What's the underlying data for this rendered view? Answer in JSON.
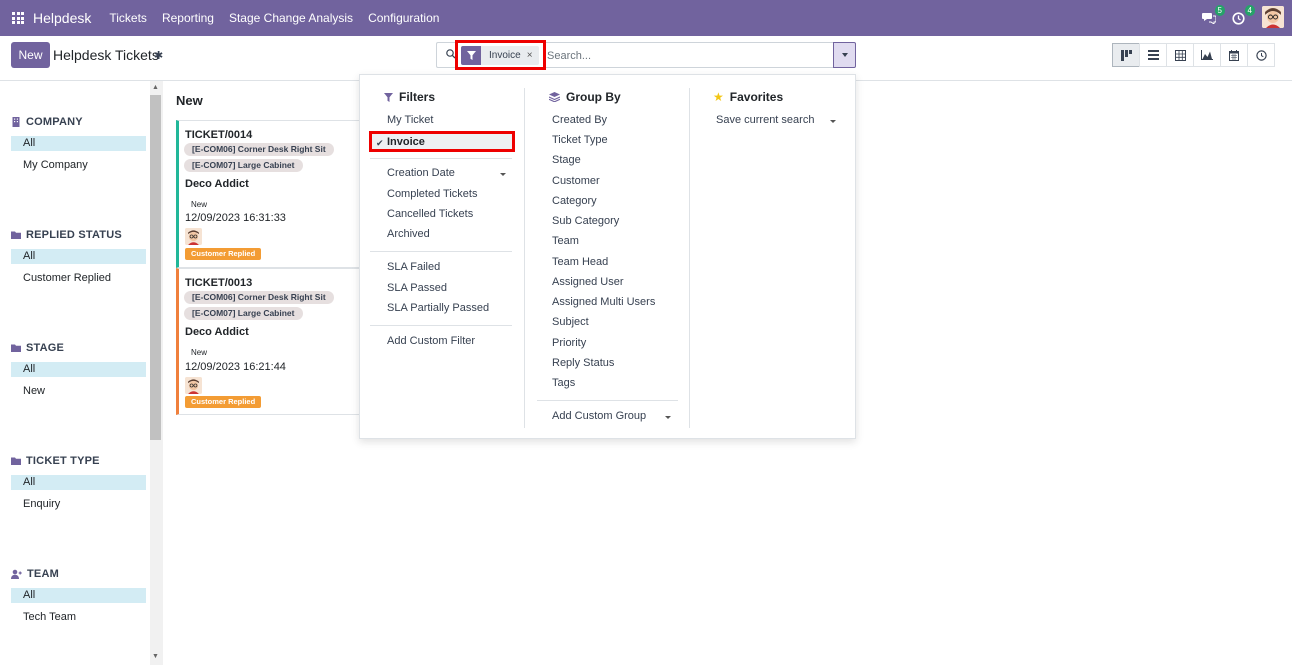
{
  "nav": {
    "brand": "Helpdesk",
    "menu": [
      "Tickets",
      "Reporting",
      "Stage Change Analysis",
      "Configuration"
    ],
    "messages_count": "5",
    "activities_count": "4"
  },
  "control": {
    "new_label": "New",
    "title": "Helpdesk Tickets",
    "facet_label": "Invoice",
    "facet_remove": "×",
    "search_placeholder": "Search..."
  },
  "sidebar": {
    "sections": [
      {
        "title": "COMPANY",
        "icon": "building-icon",
        "options": [
          "All",
          "My Company"
        ]
      },
      {
        "title": "REPLIED STATUS",
        "icon": "folder-icon",
        "options": [
          "All",
          "Customer Replied"
        ]
      },
      {
        "title": "STAGE",
        "icon": "folder-icon",
        "options": [
          "All",
          "New"
        ]
      },
      {
        "title": "TICKET TYPE",
        "icon": "folder-icon",
        "options": [
          "All",
          "Enquiry"
        ]
      },
      {
        "title": "TEAM",
        "icon": "user-plus-icon",
        "options": [
          "All",
          "Tech Team"
        ]
      }
    ]
  },
  "kanban": {
    "column_title": "New",
    "cards": [
      {
        "ref": "TICKET/0014",
        "tags": [
          "[E-COM06] Corner Desk Right Sit",
          "[E-COM07] Large Cabinet"
        ],
        "partner": "Deco Addict",
        "stage": "New",
        "date": "12/09/2023 16:31:33",
        "badge": "Customer Replied"
      },
      {
        "ref": "TICKET/0013",
        "tags": [
          "[E-COM06] Corner Desk Right Sit",
          "[E-COM07] Large Cabinet"
        ],
        "partner": "Deco Addict",
        "stage": "New",
        "date": "12/09/2023 16:21:44",
        "badge": "Customer Replied"
      }
    ]
  },
  "dropdown": {
    "filters": {
      "title": "Filters",
      "group1": [
        "My Ticket",
        "Invoice"
      ],
      "group2": [
        "Creation Date",
        "Completed Tickets",
        "Cancelled Tickets",
        "Archived"
      ],
      "group3": [
        "SLA Failed",
        "SLA Passed",
        "SLA Partially Passed"
      ],
      "add_custom": "Add Custom Filter"
    },
    "groupby": {
      "title": "Group By",
      "items": [
        "Created By",
        "Ticket Type",
        "Stage",
        "Customer",
        "Category",
        "Sub Category",
        "Team",
        "Team Head",
        "Assigned User",
        "Assigned Multi Users",
        "Subject",
        "Priority",
        "Reply Status",
        "Tags"
      ],
      "add_custom": "Add Custom Group"
    },
    "favorites": {
      "title": "Favorites",
      "save_current": "Save current search"
    }
  },
  "colors": {
    "brand": "#71639e",
    "highlight": "#ee0000",
    "badge": "#f39c34",
    "card_teal": "#21b799",
    "card_orange": "#f0803c"
  }
}
